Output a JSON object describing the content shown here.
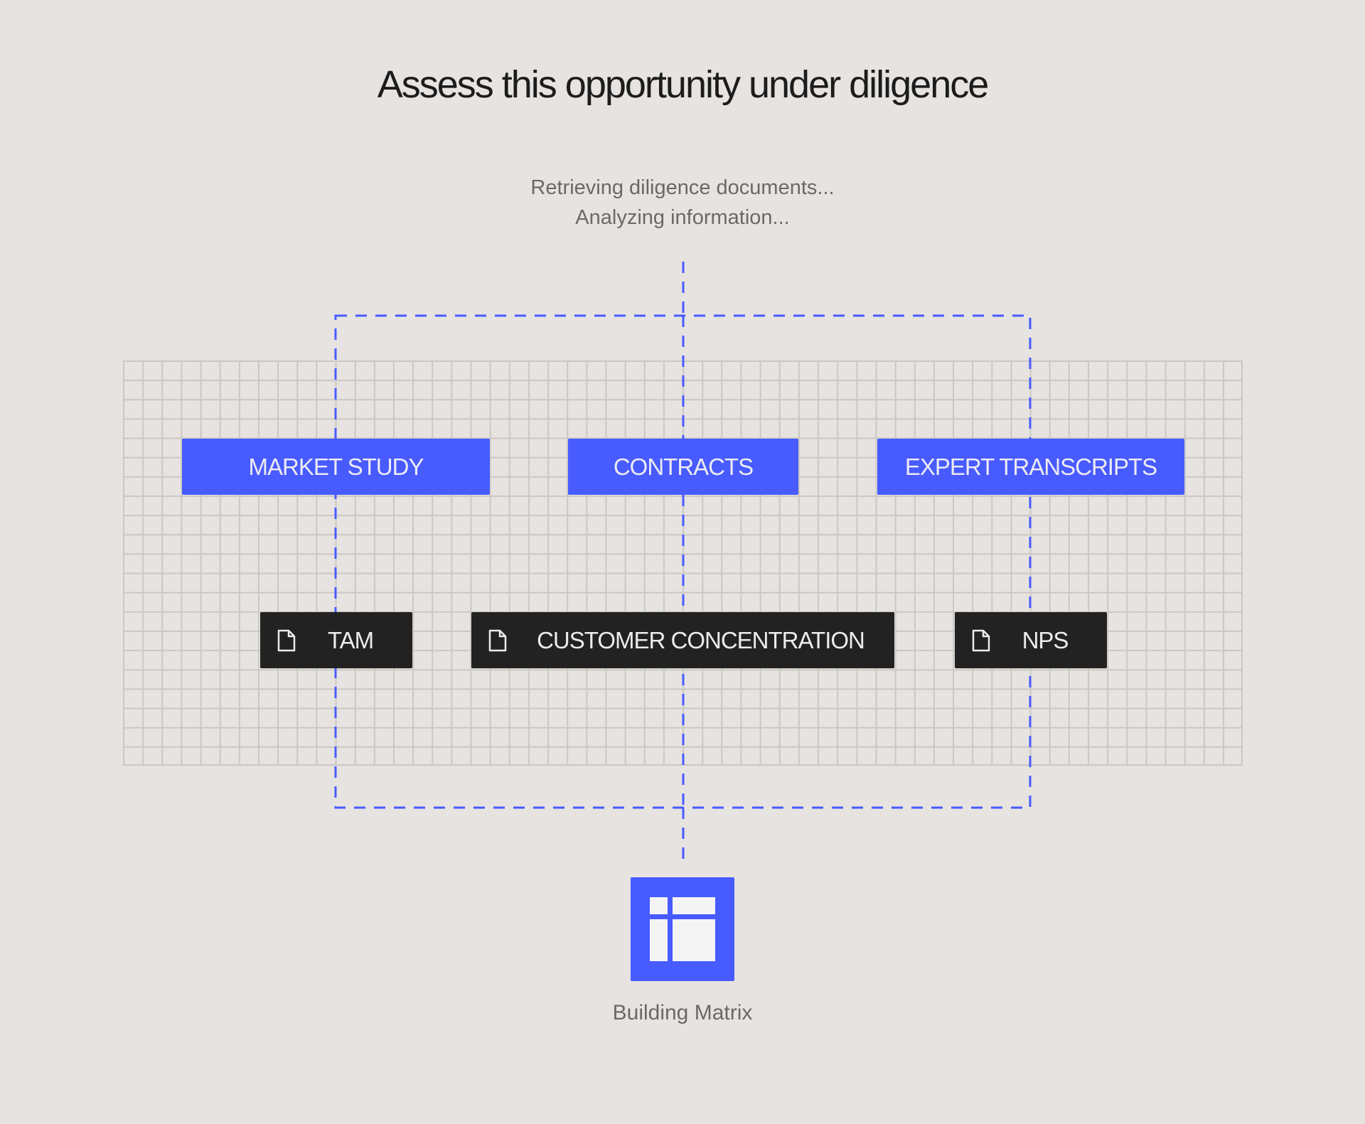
{
  "title": "Assess this opportunity under diligence",
  "status_lines": [
    "Retrieving diligence documents...",
    "Analyzing information..."
  ],
  "sources": [
    {
      "label": "MARKET STUDY"
    },
    {
      "label": "CONTRACTS"
    },
    {
      "label": "EXPERT TRANSCRIPTS"
    }
  ],
  "documents": [
    {
      "label": "TAM",
      "icon": "document-icon"
    },
    {
      "label": "CUSTOMER CONCENTRATION",
      "icon": "document-icon"
    },
    {
      "label": "NPS",
      "icon": "document-icon"
    }
  ],
  "output": {
    "label": "Building Matrix",
    "icon": "matrix-table-icon"
  },
  "colors": {
    "accent": "#475bff",
    "dark": "#222222",
    "background": "#e6e3e0",
    "muted_text": "#6b6866"
  }
}
